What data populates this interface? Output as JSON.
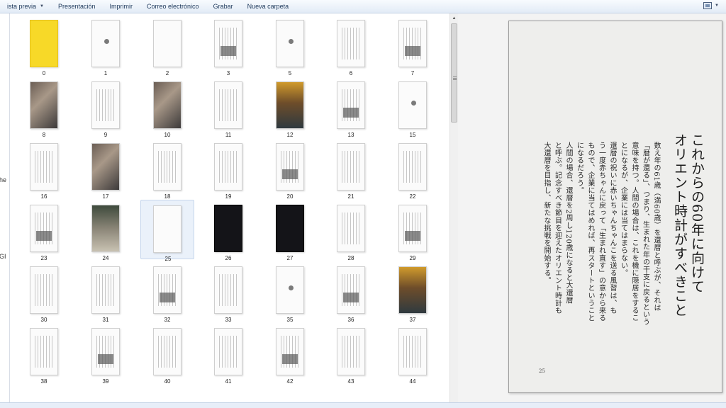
{
  "toolbar": {
    "items": [
      {
        "label": "ista previa",
        "has_arrow": true
      },
      {
        "label": "Presentación",
        "has_arrow": false
      },
      {
        "label": "Imprimir",
        "has_arrow": false
      },
      {
        "label": "Correo electrónico",
        "has_arrow": false
      },
      {
        "label": "Grabar",
        "has_arrow": false
      },
      {
        "label": "Nueva carpeta",
        "has_arrow": false
      }
    ],
    "view_icon": "view-options-icon"
  },
  "left_panel": {
    "fragments": [
      "3he",
      "LGI"
    ]
  },
  "thumbnails": [
    {
      "label": "0",
      "style": "yellow"
    },
    {
      "label": "1",
      "style": "dot"
    },
    {
      "label": "2",
      "style": "blank"
    },
    {
      "label": "3",
      "style": "text"
    },
    {
      "label": "5",
      "style": "dot"
    },
    {
      "label": "6",
      "style": "text"
    },
    {
      "label": "7",
      "style": "text"
    },
    {
      "label": "8",
      "style": "photo"
    },
    {
      "label": "9",
      "style": "text"
    },
    {
      "label": "10",
      "style": "photo"
    },
    {
      "label": "11",
      "style": "text"
    },
    {
      "label": "12",
      "style": "photo2"
    },
    {
      "label": "13",
      "style": "text"
    },
    {
      "label": "15",
      "style": "dot"
    },
    {
      "label": "16",
      "style": "text"
    },
    {
      "label": "17",
      "style": "photo"
    },
    {
      "label": "18",
      "style": "text"
    },
    {
      "label": "19",
      "style": "text"
    },
    {
      "label": "20",
      "style": "text"
    },
    {
      "label": "21",
      "style": "text"
    },
    {
      "label": "22",
      "style": "text"
    },
    {
      "label": "23",
      "style": "text"
    },
    {
      "label": "24",
      "style": "photo3"
    },
    {
      "label": "25",
      "style": "blank",
      "selected": true
    },
    {
      "label": "26",
      "style": "dark"
    },
    {
      "label": "27",
      "style": "dark"
    },
    {
      "label": "28",
      "style": "text"
    },
    {
      "label": "29",
      "style": "text"
    },
    {
      "label": "30",
      "style": "text"
    },
    {
      "label": "31",
      "style": "text"
    },
    {
      "label": "32",
      "style": "text"
    },
    {
      "label": "33",
      "style": "text"
    },
    {
      "label": "35",
      "style": "dot"
    },
    {
      "label": "36",
      "style": "text"
    },
    {
      "label": "37",
      "style": "photo2"
    },
    {
      "label": "38",
      "style": "text"
    },
    {
      "label": "39",
      "style": "text"
    },
    {
      "label": "40",
      "style": "text"
    },
    {
      "label": "41",
      "style": "text"
    },
    {
      "label": "42",
      "style": "text"
    },
    {
      "label": "43",
      "style": "text"
    },
    {
      "label": "44",
      "style": "text"
    }
  ],
  "preview": {
    "title_lines": [
      "これからの60年に向けて",
      "オリエント時計がすべきこと"
    ],
    "body_lines": [
      "数え年の61歳（満60歳）を還暦と呼ぶが、それは",
      "「暦が還る」、つまり、生まれた年の干支に戻るという",
      "意味を持つ。人間の場合は、これを機に隠居をするこ",
      "とになるが、企業には当てはまらない。",
      "還暦の祝いに赤いちゃんちゃんこを送る風習は、も",
      "う一度赤ちゃんに戻って「生まれ直す」の意から来る",
      "もので、企業に当てはめれば、再スタートということ",
      "になるだろう。",
      "人間の場合、還暦を2周し120歳になると大還暦",
      "と呼ぶ。記念すべき節目を迎えたオリエント時計も",
      "大還暦を目指し、新たな挑戦を開始する。"
    ],
    "page_number": "25"
  }
}
